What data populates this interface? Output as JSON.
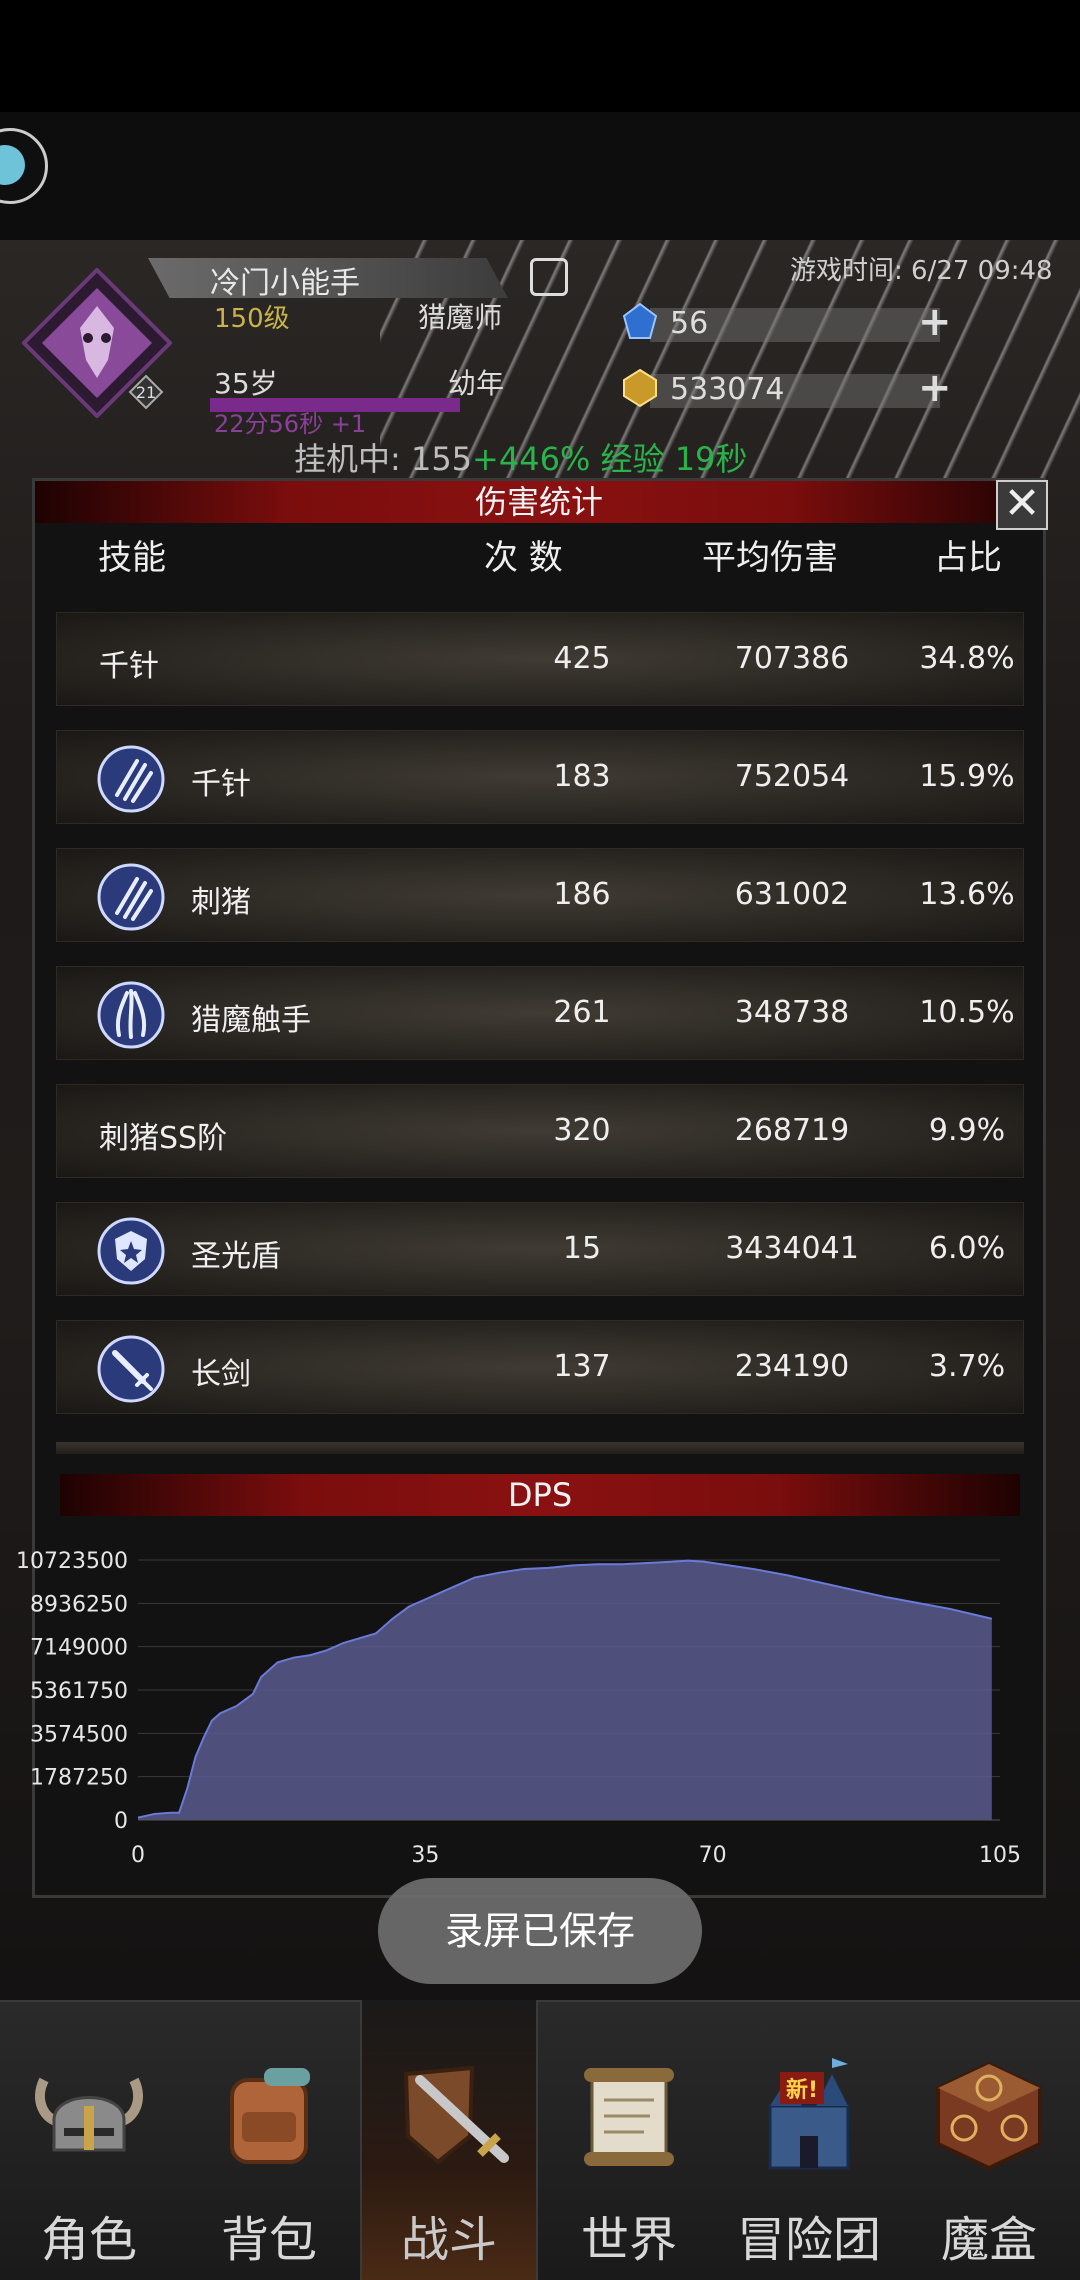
{
  "player": {
    "name": "冷门小能手",
    "level": "150级",
    "job": "猎魔师",
    "age": "35岁",
    "stage": "幼年",
    "timer": "22分56秒 +1",
    "game_time": "游戏时间: 6/27 09:48",
    "idle_prefix": "挂机中: 155",
    "idle_green": "+446% 经验 19秒",
    "emblem_level": "21"
  },
  "resources": {
    "gems": "56",
    "gold": "533074"
  },
  "modal": {
    "title": "伤害统计",
    "columns": {
      "skill": "技能",
      "count": "次 数",
      "avg": "平均伤害",
      "pct": "占比"
    },
    "rows": [
      {
        "name": "千针",
        "count": "425",
        "avg": "707386",
        "pct": "34.8%",
        "icon": "none"
      },
      {
        "name": "千针",
        "count": "183",
        "avg": "752054",
        "pct": "15.9%",
        "icon": "claw-slash-icon"
      },
      {
        "name": "刺猪",
        "count": "186",
        "avg": "631002",
        "pct": "13.6%",
        "icon": "claw-slash-icon"
      },
      {
        "name": "猎魔触手",
        "count": "261",
        "avg": "348738",
        "pct": "10.5%",
        "icon": "tentacle-icon"
      },
      {
        "name": "刺猪SS阶",
        "count": "320",
        "avg": "268719",
        "pct": "9.9%",
        "icon": "none"
      },
      {
        "name": "圣光盾",
        "count": "15",
        "avg": "3434041",
        "pct": "6.0%",
        "icon": "holy-shield-icon"
      },
      {
        "name": "长剑",
        "count": "137",
        "avg": "234190",
        "pct": "3.7%",
        "icon": "sword-icon"
      }
    ],
    "dps_title": "DPS"
  },
  "chart_data": {
    "type": "area",
    "title": "DPS",
    "xlabel": "",
    "ylabel": "",
    "xlim": [
      0,
      105
    ],
    "ylim": [
      0,
      10723500
    ],
    "x_ticks": [
      "0",
      "35",
      "70",
      "105"
    ],
    "y_ticks": [
      "0",
      "1787250",
      "3574500",
      "5361750",
      "7149000",
      "8936250",
      "10723500"
    ],
    "x": [
      0,
      2,
      4,
      5,
      6,
      7,
      8,
      9,
      10,
      12,
      14,
      15,
      17,
      19,
      21,
      23,
      25,
      27,
      29,
      31,
      33,
      35,
      37,
      39,
      41,
      44,
      47,
      50,
      53,
      56,
      59,
      62,
      65,
      67,
      69,
      72,
      75,
      79,
      83,
      87,
      91,
      95,
      99,
      104
    ],
    "series": [
      {
        "values": [
          100000,
          250000,
          300000,
          300000,
          1300000,
          2600000,
          3400000,
          4100000,
          4400000,
          4700000,
          5200000,
          5900000,
          6500000,
          6700000,
          6800000,
          7000000,
          7300000,
          7500000,
          7700000,
          8300000,
          8800000,
          9100000,
          9400000,
          9700000,
          10000000,
          10200000,
          10350000,
          10400000,
          10500000,
          10550000,
          10550000,
          10600000,
          10650000,
          10700000,
          10650000,
          10500000,
          10350000,
          10100000,
          9800000,
          9500000,
          9200000,
          8950000,
          8700000,
          8300000
        ],
        "color": "#5a5a8e"
      }
    ],
    "grid": true
  },
  "toast": "录屏已保存",
  "nav": [
    {
      "label": "角色",
      "icon": "horned-helmet-icon",
      "active": false
    },
    {
      "label": "背包",
      "icon": "backpack-icon",
      "active": false
    },
    {
      "label": "战斗",
      "icon": "sword-shield-icon",
      "active": true
    },
    {
      "label": "世界",
      "icon": "scroll-map-icon",
      "active": false
    },
    {
      "label": "冒险团",
      "icon": "castle-icon",
      "active": false,
      "badge": "新!"
    },
    {
      "label": "魔盒",
      "icon": "magic-box-icon",
      "active": false
    }
  ],
  "colors": {
    "title_red": "#8a1111",
    "chart_fill": "#5a5a8e",
    "chart_line": "#6a7ad8",
    "level_gold": "#c9b34a",
    "idle_green": "#29b34a"
  }
}
